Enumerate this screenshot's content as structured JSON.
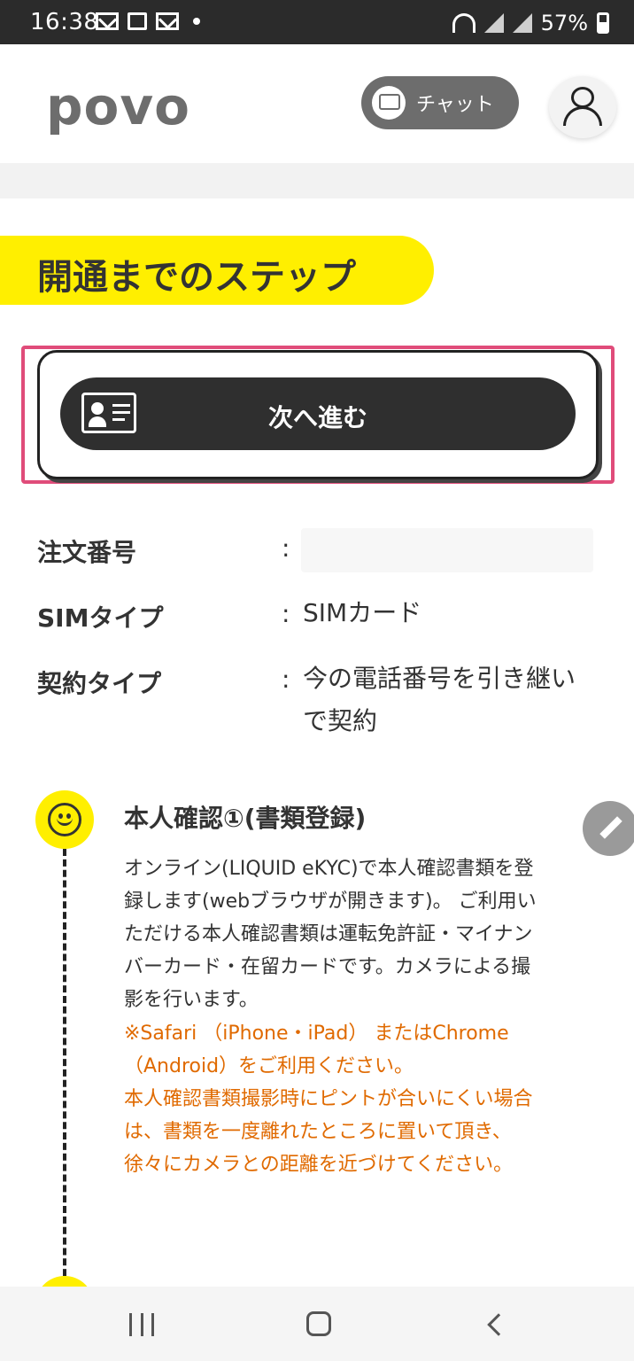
{
  "status_bar": {
    "time": "16:38",
    "battery_text": "57%"
  },
  "header": {
    "logo_text": "povo",
    "chat_label": "チャット"
  },
  "page_title": "開通までのステップ",
  "next_button_label": "次へ進む",
  "order_info": {
    "order_number_label": "注文番号",
    "order_number_value": "",
    "sim_type_label": "SIMタイプ",
    "sim_type_value": "SIMカード",
    "contract_type_label": "契約タイプ",
    "contract_type_value": "今の電話番号を引き継いで契約",
    "colon": ":"
  },
  "step1": {
    "title": "本人確認①(書類登録)",
    "body": "オンライン(LIQUID eKYC)で本人確認書類を登録します(webブラウザが開きます)。 ご利用いただける本人確認書類は運転免許証・マイナンバーカード・在留カードです。カメラによる撮影を行います。",
    "note_line1": "※Safari （iPhone・iPad） またはChrome（Android）をご利用ください。",
    "note_line2": "本人確認書類撮影時にピントが合いにくい場合は、書類を一度離れたところに置いて頂き、徐々にカメラとの距離を近づけてください。"
  },
  "colors": {
    "accent_yellow": "#ffef00",
    "highlight_pink": "#e04c7a",
    "note_orange": "#e06a00",
    "button_dark": "#2f2f2f"
  }
}
